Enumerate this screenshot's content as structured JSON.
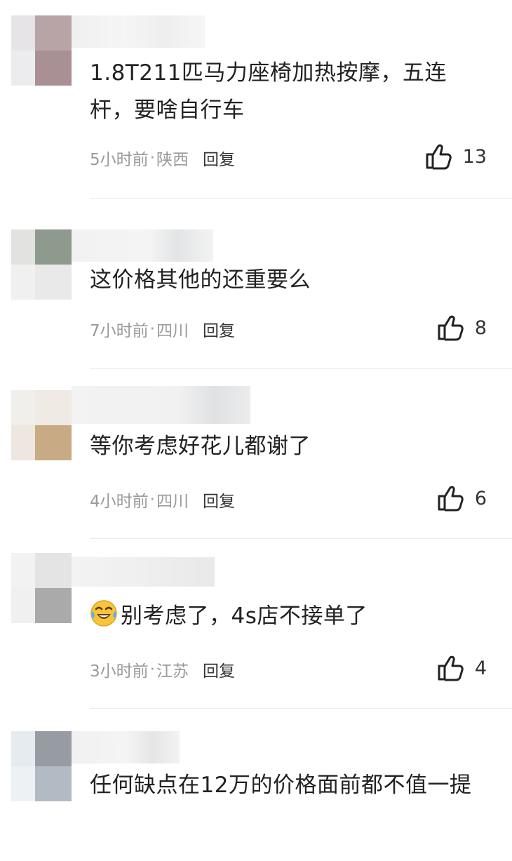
{
  "comments": [
    {
      "text": "1.8T211匹马力座椅加热按摩，五连杆，要啥自行车",
      "time": "5小时前",
      "region": "陕西",
      "reply_label": "回复",
      "likes": "13",
      "emoji": ""
    },
    {
      "text": "这价格其他的还重要么",
      "time": "7小时前",
      "region": "四川",
      "reply_label": "回复",
      "likes": "8",
      "emoji": ""
    },
    {
      "text": "等你考虑好花儿都谢了",
      "time": "4小时前",
      "region": "四川",
      "reply_label": "回复",
      "likes": "6",
      "emoji": ""
    },
    {
      "text": "别考虑了，4s店不接单了",
      "time": "3小时前",
      "region": "江苏",
      "reply_label": "回复",
      "likes": "4",
      "emoji": "laughing-crying-emoji"
    },
    {
      "text": "任何缺点在12万的价格面前都不值一提",
      "time": "",
      "region": "",
      "reply_label": "",
      "likes": "",
      "emoji": ""
    }
  ],
  "separator": "·",
  "icons": {
    "like": "thumbs-up-icon"
  },
  "colors": {
    "text": "#222222",
    "meta": "#9a9a9a",
    "reply": "#333333",
    "divider": "#ececec"
  }
}
